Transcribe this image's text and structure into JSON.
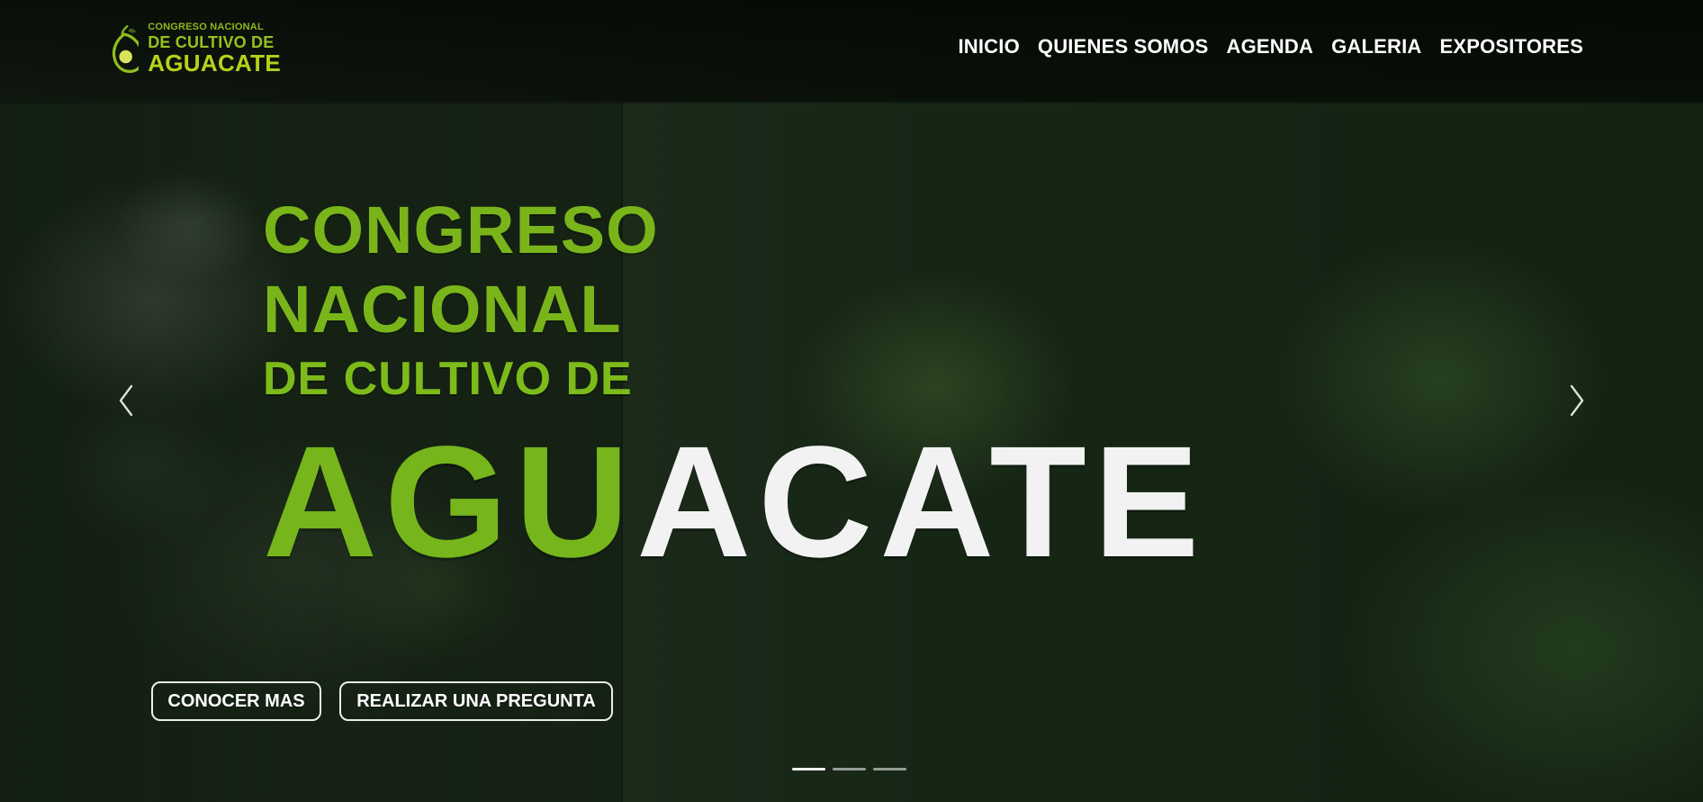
{
  "header": {
    "logo": {
      "line1": "CONGRESO NACIONAL",
      "line2": "DE CULTIVO DE",
      "line3": "AGUACATE"
    },
    "nav": [
      {
        "label": "INICIO"
      },
      {
        "label": "QUIENES SOMOS"
      },
      {
        "label": "AGENDA"
      },
      {
        "label": "GALERIA"
      },
      {
        "label": "EXPOSITORES"
      }
    ]
  },
  "hero": {
    "line1": "CONGRESO",
    "line2": "NACIONAL",
    "line3": "DE CULTIVO DE",
    "big_left": "AGU",
    "big_right": "ACATE",
    "buttons": {
      "primary": "CONOCER MAS",
      "secondary": "REALIZAR UNA PREGUNTA"
    }
  },
  "carousel": {
    "slides_total": 3,
    "active_slide": 1
  },
  "colors": {
    "brand_green": "#79b51a",
    "brand_lime": "#b7d21a",
    "nav_text": "#ffffff"
  },
  "icons": {
    "logo": "avocado-logo-icon",
    "prev": "chevron-left-icon",
    "next": "chevron-right-icon"
  }
}
